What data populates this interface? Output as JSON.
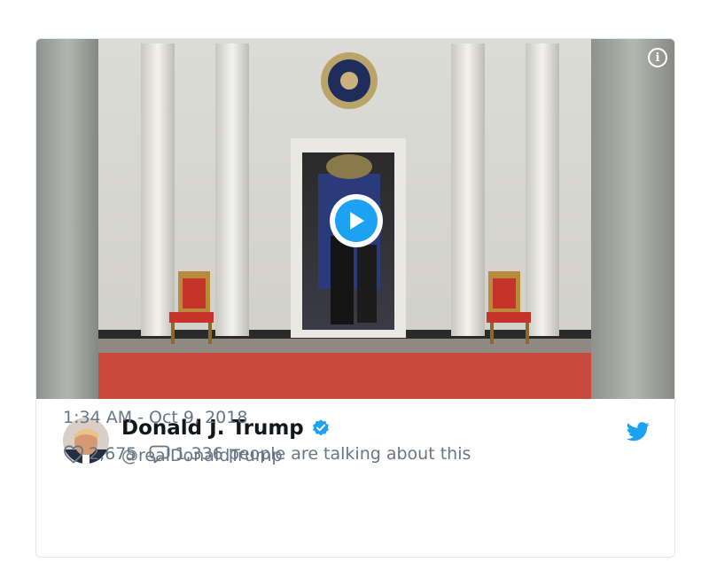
{
  "tweet": {
    "display_name": "Donald J. Trump",
    "handle": "@realDonaldTrump",
    "timestamp": "1:34 AM - Oct 9, 2018",
    "likes": "2,675",
    "talking": "1,336 people are talking about this"
  },
  "media": {
    "info_glyph": "i",
    "play_icon": "play-icon"
  },
  "icons": {
    "verified": "verified-badge-icon",
    "bird": "twitter-bird-icon",
    "heart": "heart-icon",
    "comment": "comment-icon",
    "info": "info-icon"
  },
  "colors": {
    "accent": "#1da1f2",
    "text_primary": "#14171a",
    "text_secondary": "#657786",
    "border": "#e1e8ed"
  }
}
